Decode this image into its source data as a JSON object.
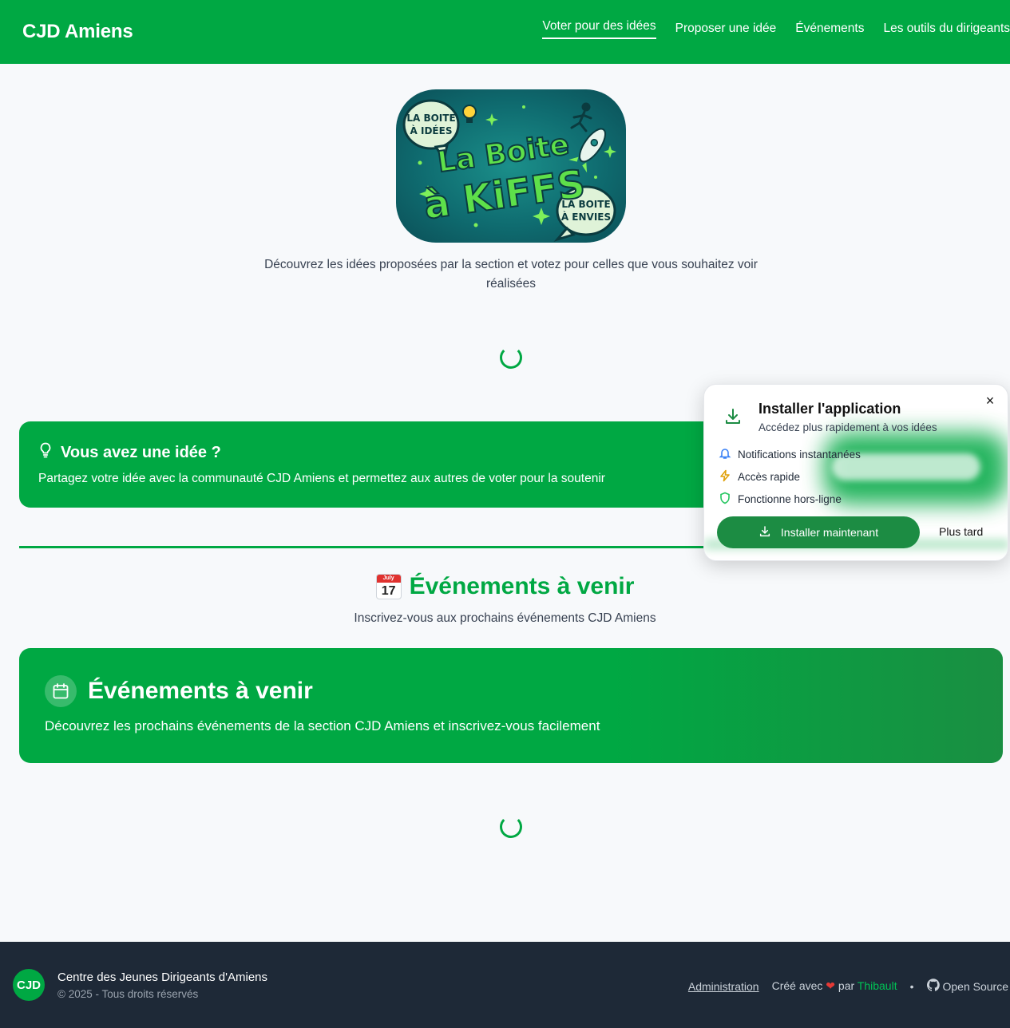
{
  "header": {
    "brand": "CJD Amiens",
    "nav": [
      "Voter pour des idées",
      "Proposer une idée",
      "Événements",
      "Les outils du dirigeants"
    ]
  },
  "logo": {
    "main_line1": "La Boite",
    "main_line2": "à KiFFS",
    "bubble_left_line1": "LA BOITE",
    "bubble_left_line2": "À IDÉES",
    "bubble_right_line1": "LA BOITE",
    "bubble_right_line2": "À ENVIES"
  },
  "intro": "Découvrez les idées proposées par la section et votez pour celles que vous souhaitez voir réalisées",
  "idea_card": {
    "title": "Vous avez une idée ?",
    "description": "Partagez votre idée avec la communauté CJD Amiens et permettez aux autres de voter pour la soutenir"
  },
  "events": {
    "emoji_month": "July",
    "emoji_day": "17",
    "heading": "Événements à venir",
    "subheading": "Inscrivez-vous aux prochains événements CJD Amiens",
    "card_title": "Événements à venir",
    "card_description": "Découvrez les prochains événements de la section CJD Amiens et inscrivez-vous facilement"
  },
  "install_popup": {
    "title": "Installer l'application",
    "subtitle": "Accédez plus rapidement à vos idées",
    "features": [
      "Notifications instantanées",
      "Accès rapide",
      "Fonctionne hors-ligne"
    ],
    "install_button": "Installer maintenant",
    "later_button": "Plus tard",
    "close": "×"
  },
  "footer": {
    "badge": "CJD",
    "org": "Centre des Jeunes Dirigeants d'Amiens",
    "copyright": "© 2025 - Tous droits réservés",
    "admin_link": "Administration",
    "made_with": "Créé avec",
    "by": "par",
    "author": "Thibault",
    "open_source": "Open Source"
  },
  "colors": {
    "brand_green": "#00a843",
    "footer_bg": "#1e2937",
    "page_bg": "#f7f9fb"
  }
}
